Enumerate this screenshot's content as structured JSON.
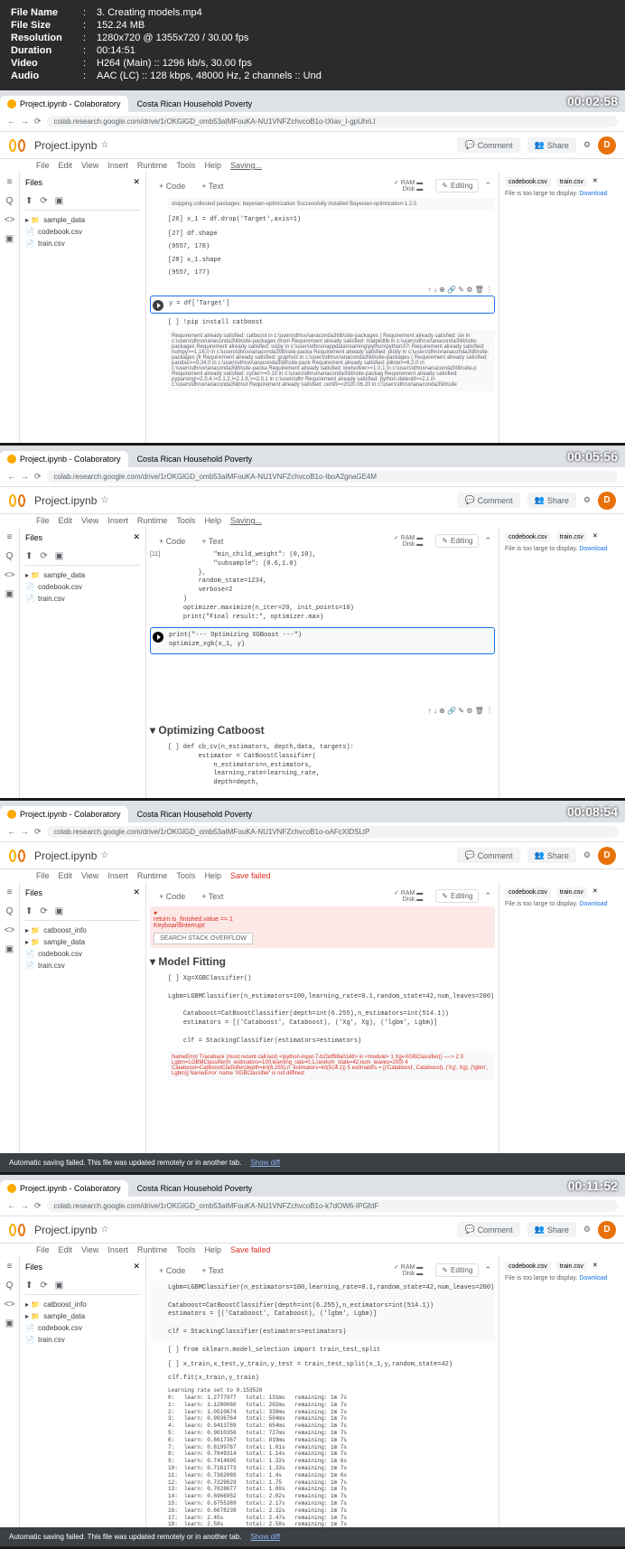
{
  "header": {
    "file_name": {
      "label": "File Name",
      "value": "3. Creating models.mp4"
    },
    "file_size": {
      "label": "File Size",
      "value": "152.24 MB"
    },
    "resolution": {
      "label": "Resolution",
      "value": "1280x720 @ 1355x720 / 30.00 fps"
    },
    "duration": {
      "label": "Duration",
      "value": "00:14:51"
    },
    "video": {
      "label": "Video",
      "value": "H264 (Main) :: 1296 kb/s, 30.00 fps"
    },
    "audio": {
      "label": "Audio",
      "value": "AAC (LC) :: 128 kbps, 48000 Hz, 2 channels :: Und"
    }
  },
  "frames": [
    {
      "timestamp": "00:02:58",
      "url": "colab.research.google.com/drive/1rOKGlGD_omb53aIMFouKA-NU1VNFZchvcoB1o-tXiav_I-gpUhrLl"
    },
    {
      "timestamp": "00:05:56",
      "url": "colab.research.google.com/drive/1rOKGlGD_omb53aIMFouKA-NU1VNFZchvcoB1o-IboA2gnaGE4M"
    },
    {
      "timestamp": "00:08:54",
      "url": "colab.research.google.com/drive/1rOKGlGD_omb53aIMFouKA-NU1VNFZchvcoB1o-oAFcXIDSLtP"
    },
    {
      "timestamp": "00:11:52",
      "url": "colab.research.google.com/drive/1rOKGlGD_omb53aIMFouKA-NU1VNFZchvcoB1o-k7dOW6-IPGfdF"
    }
  ],
  "tabs": {
    "tab1": "Project.ipynb - Colaboratory",
    "tab2": "Costa Rican Household Poverty"
  },
  "colab": {
    "project": "Project.ipynb",
    "menu": [
      "File",
      "Edit",
      "View",
      "Insert",
      "Runtime",
      "Tools",
      "Help"
    ],
    "saving": "Saving...",
    "save_failed": "Save failed",
    "comment": "Comment",
    "share": "Share",
    "avatar": "D",
    "code_btn": "+ Code",
    "text_btn": "+ Text",
    "ram": "RAM",
    "disk": "Disk",
    "editing": "Editing",
    "files": "Files"
  },
  "sidebar": {
    "items1": [
      "sample_data",
      "codebook.csv",
      "train.csv"
    ],
    "items3": [
      "catboost_info",
      "sample_data",
      "codebook.csv",
      "train.csv"
    ]
  },
  "right_panel": {
    "tab1": "codebook.csv",
    "tab2": "train.csv",
    "message": "File is too large to display.",
    "download": "Download"
  },
  "frame1_cells": {
    "install_output": "stopping collected packages: bayesian-optimization\nSuccessfully installed Bayesian-optimization-1.2.0",
    "cell26": "[26] x_1 = df.drop('Target',axis=1)",
    "cell27_in": "[27] df.shape",
    "cell27_out": "(9557, 178)",
    "cell28_in": "[28] x_1.shape",
    "cell28_out": "(9557, 177)",
    "cell_active": "y = df['Target']",
    "pip_cell": "[ ] !pip install catboost",
    "pip_output": "Requirement already satisfied: catboost in c:\\users\\dhruv\\anaconda3\\lib\\site-packages (\nRequirement already satisfied: six in c:\\users\\dhruv\\anaconda3\\lib\\site-packages (from\nRequirement already satisfied: matplotlib in c:\\users\\dhruv\\anaconda3\\lib\\site-packages\nRequirement already satisfied: scipy in c:\\users\\dhruv\\appdata\\roaming\\python\\python37\\\nRequirement already satisfied: numpy>=1.16.0 in c:\\users\\dhruv\\anaconda3\\lib\\site-packa\nRequirement already satisfied: plotly in c:\\users\\dhruv\\anaconda3\\lib\\site-packages (fr\nRequirement already satisfied: graphviz in c:\\users\\dhruv\\anaconda3\\lib\\site-packages (\nRequirement already satisfied: pandas>=0.24.0 in c:\\users\\dhruv\\anaconda3\\lib\\site-pack\nRequirement already satisfied: pillow>=6.2.0 in c:\\users\\dhruv\\anaconda3\\lib\\site-packa\nRequirement already satisfied: kiwisolver>=1.0.1 in c:\\users\\dhruv\\anaconda3\\lib\\site-p\nRequirement already satisfied: cycler>=0.10 in c:\\users\\dhruv\\anaconda3\\lib\\site-packag\nRequirement already satisfied: pyparsing!=2.0.4,!=2.1.2,!=2.1.6,>=2.0.1 in c:\\users\\dhr\nRequirement already satisfied: python-dateutil>=2.1 in c:\\users\\dhruv\\anaconda3\\lib\\sit\nRequirement already satisfied: certifi>=2020.06.20 in c:\\users\\dhruv\\anaconda3\\lib\\site"
  },
  "frame2_cells": {
    "cell_code": "            \"min_child_weight\": (0,10),\n            \"subsample\": (0.6,1.0)\n        },\n        random_state=1234,\n        verbose=2\n    )\n    optimizer.maximize(n_iter=20, init_points=10)\n    print(\"Final result:\", optimizer.max)",
    "cell_active": "print(\"--- Optimizing XGBoost ---\")\noptimize_xgb(x_1, y)",
    "section": "Optimizing Catboost",
    "def_cell": "[ ] def cb_cv(n_estimators, depth,data, targets):\n        estimator = CatBoostClassifier(\n            n_estimators=n_estimators,\n            learning_rate=learning_rate,\n            depth=depth,"
  },
  "frame3_cells": {
    "error1": "return is_finished.value == 1",
    "error2": "KeyboardInterrupt:",
    "search_btn": "SEARCH STACK OVERFLOW",
    "section": "Model Fitting",
    "code": "[ ] Xg=XGBClassifier()\n    Lgbm=LGBMClassifier(n_estimators=100,learning_rate=0.1,random_state=42,num_leaves=200)\n\n    Cataboost=CatBoostClassifier(depth=int(6.255),n_estimators=int(514.1))\n    estimators = [('Cataboost', Cataboost), ('Xg', Xg), ('lgbm', Lgbm)]\n\n    clf = StackingClassifier(estimators=estimators)",
    "traceback": "NameError                                 Traceback (most recent call last)\n<ipython-input-7-b23df98a0148> in <module>\n      1 Xg=XGBClassifier()\n----> 2\n      3 Lgbm=LGBMClassifier(n_estimators=100,learning_rate=0.1,random_state=42,num_leaves=200)\n      4 Cataboost=CatBoostClassifier(depth=int(6.255),n_estimators=int(514.1))\n      5 estimators = [('Cataboost', Cataboost), ('Xg', Xg), ('lgbm', Lgbm)]\n\nNameError: name 'XGBClassifier' is not defined",
    "banner": "Automatic saving failed. This file was updated remotely or in another tab.",
    "show_diff": "Show diff"
  },
  "frame4_cells": {
    "code1": "Lgbm=LGBMClassifier(n_estimators=100,learning_rate=0.1,random_state=42,num_leaves=200)\n\nCataboost=CatBoostClassifier(depth=int(6.255),n_estimators=int(514.1))\nestimators = [('Cataboost', Cataboost), ('lgbm', Lgbm)]\n\nclf = StackingClassifier(estimators=estimators)",
    "import_cell": "[ ] from sklearn.model_selection import train_test_split",
    "split_cell": "[ ] x_train,x_test,y_train,y_test = train_test_split(x_1,y,random_state=42)",
    "fit_cell": "clf.fit(x_train,y_train)",
    "training_output": "Learning rate set to 0.153526\n0:   learn: 1.2777977   total: 131ms   remaining: 1m 7s\n1:   learn: 1.1280060   total: 202ms   remaining: 1m 7s\n2:   learn: 1.0510674   total: 339ms   remaining: 1m 7s\n3:   learn: 0.9936764   total: 504ms   remaining: 1m 7s\n4:   learn: 0.9413789   total: 654ms   remaining: 1m 7s\n5:   learn: 0.9010350   total: 727ms   remaining: 1m 7s\n6:   learn: 0.8617367   total: 819ms   remaining: 1m 7s\n7:   learn: 0.8199767   total: 1.01s   remaining: 1m 7s\n8:   learn: 0.7849314   total: 1.14s   remaining: 1m 7s\n9:   learn: 0.7414605   total: 1.32s   remaining: 1m 6s\n10:  learn: 0.7161773   total: 1.33s   remaining: 1m 7s\n11:  learn: 0.7362089   total: 1.4s    remaining: 1m 6s\n12:  learn: 0.7329629   total: 1.75    remaining: 1m 7s\n13:  learn: 0.7028677   total: 1.89s   remaining: 1m 7s\n14:  learn: 0.6966952   total: 2.02s   remaining: 1m 7s\n15:  learn: 0.6755389   total: 2.17s   remaining: 1m 7s\n16:  learn: 0.6678239   total: 2.32s   remaining: 1m 7s\n17:  learn: 2.45s       total: 2.47s   remaining: 1m 7s\n18:  learn: 2.58s       total: 2.58s   remaining: 1m 7s",
    "banner": "Automatic saving failed. This file was updated remotely or in another tab.",
    "show_diff": "Show diff"
  }
}
